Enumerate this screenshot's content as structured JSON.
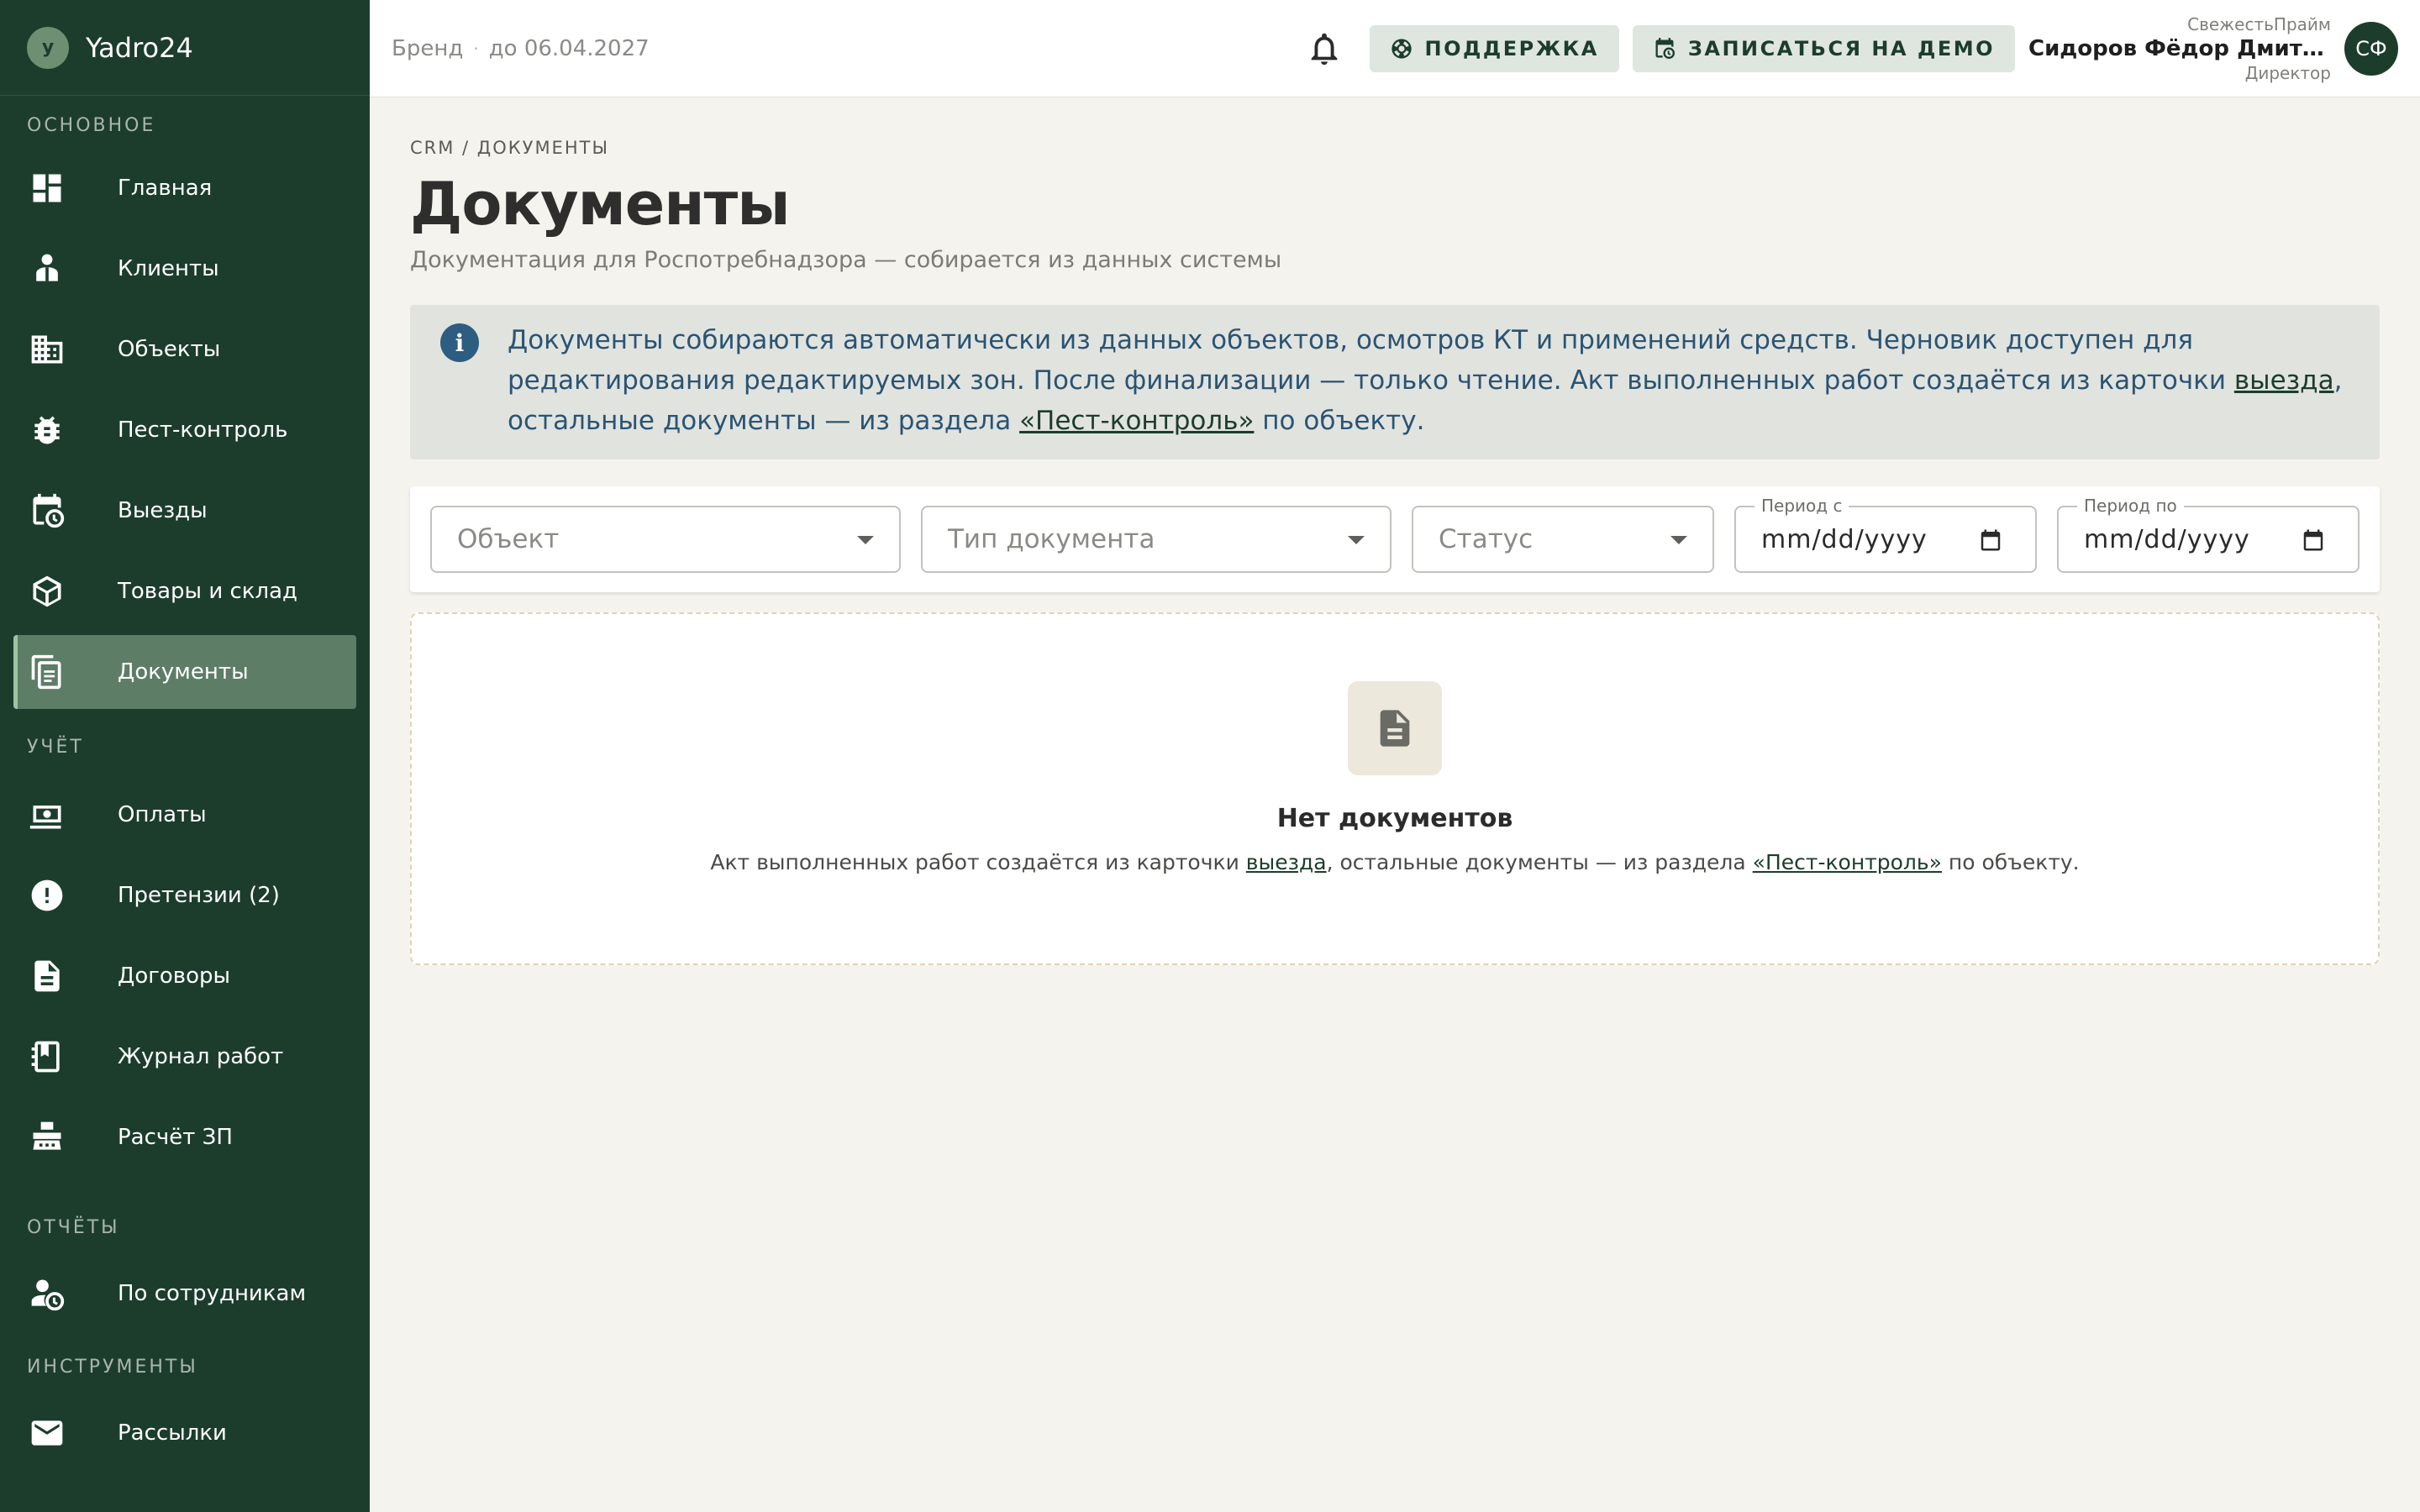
{
  "brand": {
    "logo_letter": "y",
    "name": "Yadro24"
  },
  "sidebar": {
    "sections": [
      {
        "title": "ОСНОВНОЕ"
      },
      {
        "title": "УЧЁТ"
      },
      {
        "title": "ОТЧЁТЫ"
      },
      {
        "title": "ИНСТРУМЕНТЫ"
      }
    ],
    "items": [
      {
        "label": "Главная",
        "icon": "dashboard-icon"
      },
      {
        "label": "Клиенты",
        "icon": "clients-icon"
      },
      {
        "label": "Объекты",
        "icon": "building-icon"
      },
      {
        "label": "Пест-контроль",
        "icon": "bug-icon"
      },
      {
        "label": "Выезды",
        "icon": "calendar-clock-icon"
      },
      {
        "label": "Товары и склад",
        "icon": "package-icon"
      },
      {
        "label": "Документы",
        "icon": "documents-icon",
        "active": true
      },
      {
        "label": "Оплаты",
        "icon": "cash-icon"
      },
      {
        "label": "Претензии (2)",
        "icon": "alert-icon"
      },
      {
        "label": "Договоры",
        "icon": "contract-icon"
      },
      {
        "label": "Журнал работ",
        "icon": "journal-icon"
      },
      {
        "label": "Расчёт ЗП",
        "icon": "cash-register-icon"
      },
      {
        "label": "По сотрудникам",
        "icon": "user-clock-icon"
      },
      {
        "label": "Рассылки",
        "icon": "mail-icon"
      }
    ]
  },
  "header": {
    "brand_label": "Бренд",
    "separator": "·",
    "date_label": "до 06.04.2027",
    "support_label": "ПОДДЕРЖКА",
    "demo_label": "ЗАПИСАТЬСЯ НА ДЕМО",
    "user": {
      "company": "СвежестьПрайм",
      "name": "Сидоров Фёдор Дмитриевич",
      "role": "Директор",
      "initials": "СФ"
    }
  },
  "main": {
    "breadcrumb": "CRM / ДОКУМЕНТЫ",
    "title": "Документы",
    "subtitle": "Документация для Роспотребнадзора — собирается из данных системы",
    "info": {
      "icon_glyph": "i",
      "text_1": "Документы собираются автоматически из данных объектов, осмотров КТ и применений средств. Черновик доступен для редактирования редактируемых зон. После финализации — только чтение. Акт выполненных работ создаётся из карточки ",
      "link_1": "выезда",
      "text_2": ", остальные документы — из раздела ",
      "link_2": "«Пест-контроль»",
      "text_3": " по объекту."
    },
    "filters": {
      "object_placeholder": "Объект",
      "doc_type_placeholder": "Тип документа",
      "status_placeholder": "Статус",
      "period_from_label": "Период с",
      "period_from_value": "mm/dd/yyyy",
      "period_to_label": "Период по",
      "period_to_value": "mm/dd/yyyy"
    },
    "empty": {
      "title": "Нет документов",
      "text_1": "Акт выполненных работ создаётся из карточки ",
      "link_1": "выезда",
      "text_2": ", остальные документы — из раздела ",
      "link_2": "«Пест-контроль»",
      "text_3": " по объекту."
    }
  },
  "colors": {
    "sidebar_bg": "#1c3d2c",
    "active_item_bg": "#5d7d67",
    "accent_link": "#1c3d2c",
    "info_bg": "#e1e3df",
    "info_text": "#2a5473",
    "page_bg": "#f5f3ee"
  }
}
